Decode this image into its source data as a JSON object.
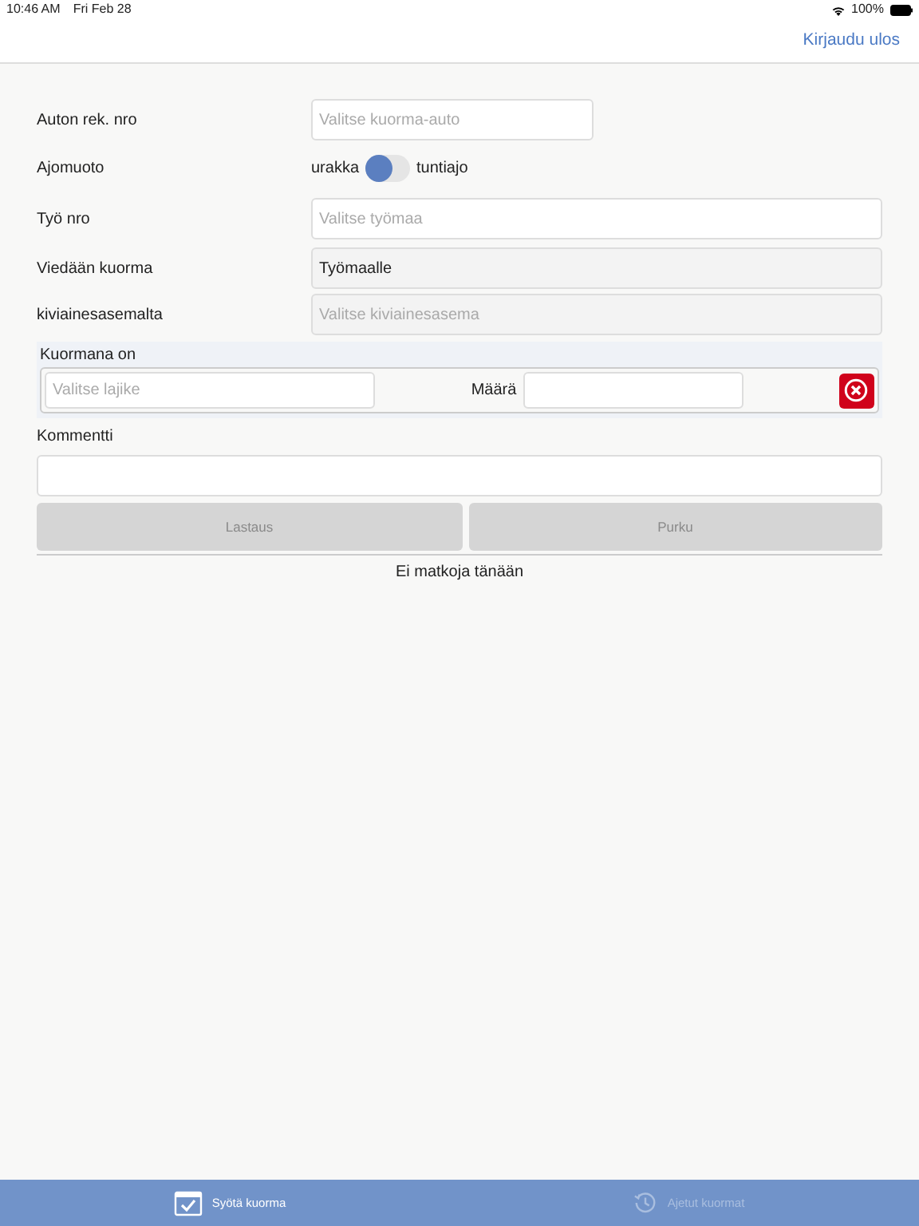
{
  "status_bar": {
    "time": "10:46 AM",
    "date": "Fri Feb 28",
    "battery": "100%"
  },
  "header": {
    "logout": "Kirjaudu ulos"
  },
  "form": {
    "vehicle": {
      "label": "Auton rek. nro",
      "placeholder": "Valitse kuorma-auto"
    },
    "mode": {
      "label": "Ajomuoto",
      "left": "urakka",
      "right": "tuntiajo",
      "on": false
    },
    "job": {
      "label": "Työ nro",
      "placeholder": "Valitse työmaa"
    },
    "destination": {
      "label": "Viedään kuorma",
      "value": "Työmaalle"
    },
    "station": {
      "label": "kiviainesasemalta",
      "placeholder": "Valitse kiviainesasema"
    },
    "load": {
      "title": "Kuormana on",
      "type_placeholder": "Valitse lajike",
      "amount_label": "Määrä"
    },
    "comment": {
      "label": "Kommentti"
    },
    "buttons": [
      {
        "label": "Lastaus",
        "disabled": true
      },
      {
        "label": "Purku",
        "disabled": true
      }
    ],
    "empty_message": "Ei matkoja tänään"
  },
  "tabs": [
    {
      "label": "Syötä kuorma",
      "selected": true,
      "kind": "calendar"
    },
    {
      "label": "Ajetut kuormat",
      "selected": false,
      "kind": "history"
    }
  ]
}
